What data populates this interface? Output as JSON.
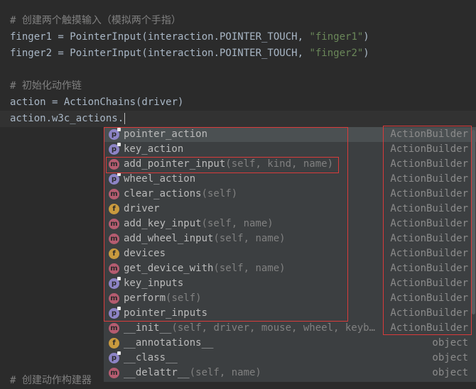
{
  "editor": {
    "lines": {
      "l1": "# 创建两个触摸输入（模拟两个手指）",
      "l2_a": "finger1 = PointerInput(interaction.POINTER_TOUCH, ",
      "l2_b": "\"finger1\"",
      "l2_c": ")",
      "l3_a": "finger2 = PointerInput(interaction.POINTER_TOUCH, ",
      "l3_b": "\"finger2\"",
      "l3_c": ")",
      "l5": "# 初始化动作链",
      "l6": "action = ActionChains(driver)",
      "l7": "action.w3c_actions.",
      "l_bottom": "# 创建动作构建器"
    }
  },
  "completion": {
    "items": [
      {
        "icon": "p",
        "name": "pointer_action",
        "params": "",
        "type": "ActionBuilder"
      },
      {
        "icon": "p",
        "name": "key_action",
        "params": "",
        "type": "ActionBuilder"
      },
      {
        "icon": "m",
        "name": "add_pointer_input",
        "params": "(self, kind, name)",
        "type": "ActionBuilder"
      },
      {
        "icon": "p",
        "name": "wheel_action",
        "params": "",
        "type": "ActionBuilder"
      },
      {
        "icon": "m",
        "name": "clear_actions",
        "params": "(self)",
        "type": "ActionBuilder"
      },
      {
        "icon": "f",
        "name": "driver",
        "params": "",
        "type": "ActionBuilder"
      },
      {
        "icon": "m",
        "name": "add_key_input",
        "params": "(self, name)",
        "type": "ActionBuilder"
      },
      {
        "icon": "m",
        "name": "add_wheel_input",
        "params": "(self, name)",
        "type": "ActionBuilder"
      },
      {
        "icon": "f",
        "name": "devices",
        "params": "",
        "type": "ActionBuilder"
      },
      {
        "icon": "m",
        "name": "get_device_with",
        "params": "(self, name)",
        "type": "ActionBuilder"
      },
      {
        "icon": "p",
        "name": "key_inputs",
        "params": "",
        "type": "ActionBuilder"
      },
      {
        "icon": "m",
        "name": "perform",
        "params": "(self)",
        "type": "ActionBuilder"
      },
      {
        "icon": "p",
        "name": "pointer_inputs",
        "params": "",
        "type": "ActionBuilder"
      },
      {
        "icon": "m",
        "name": "__init__",
        "params": "(self, driver, mouse, wheel, keyb…",
        "type": "ActionBuilder"
      },
      {
        "icon": "f",
        "name": "__annotations__",
        "params": "",
        "type": "object"
      },
      {
        "icon": "p",
        "name": "__class__",
        "params": "",
        "type": "object"
      },
      {
        "icon": "m",
        "name": "__delattr__",
        "params": "(self, name)",
        "type": "object"
      }
    ]
  },
  "colors": {
    "background": "#2b2b2b",
    "popup": "#3c3f41",
    "selected_row": "#4b5052",
    "annotation_red": "#d93b3b",
    "method_icon": "#b55c70",
    "property_icon": "#8d84c6",
    "field_icon": "#c99a3e"
  }
}
